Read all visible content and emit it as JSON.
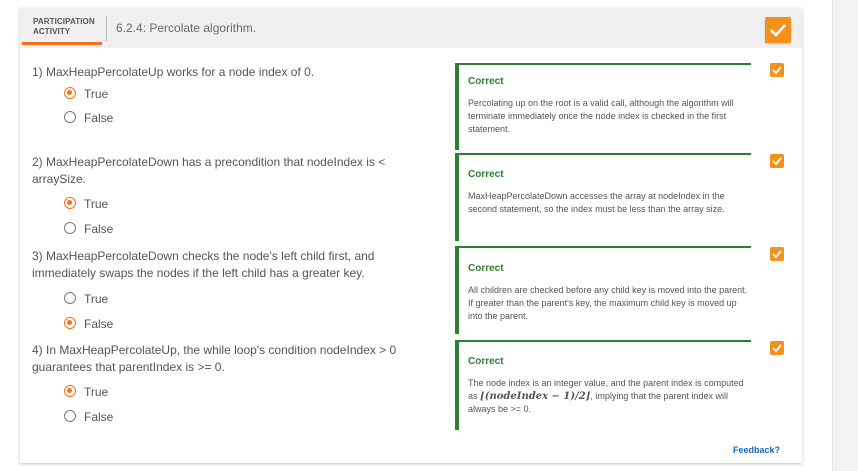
{
  "header": {
    "label_line1": "PARTICIPATION",
    "label_line2": "ACTIVITY",
    "title": "6.2.4: Percolate algorithm.",
    "completion_icon": "check-icon"
  },
  "questions": [
    {
      "text": "1) MaxHeapPercolateUp works for a node index of 0.",
      "options": [
        "True",
        "False"
      ],
      "selected": "True",
      "feedback_title": "Correct",
      "feedback_body": "Percolating up on the root is a valid call, although the algorithm will terminate immediately once the node index is checked in the first statement."
    },
    {
      "text": "2) MaxHeapPercolateDown has a precondition that nodeIndex is < arraySize.",
      "options": [
        "True",
        "False"
      ],
      "selected": "True",
      "feedback_title": "Correct",
      "feedback_body": "MaxHeapPercolateDown accesses the array at nodeIndex in the second statement, so the index must be less than the array size."
    },
    {
      "text": "3) MaxHeapPercolateDown checks the node's left child first, and immediately swaps the nodes if the left child has a greater key.",
      "options": [
        "True",
        "False"
      ],
      "selected": "False",
      "feedback_title": "Correct",
      "feedback_body": "All children are checked before any child key is moved into the parent. If greater than the parent's key, the maximum child key is moved up into the parent."
    },
    {
      "text": "4) In MaxHeapPercolateUp, the while loop's condition nodeIndex > 0 guarantees that parentIndex is >= 0.",
      "options": [
        "True",
        "False"
      ],
      "selected": "True",
      "feedback_title": "Correct",
      "feedback_body_pre": "The node index is an integer value, and the parent index is computed as ",
      "feedback_math": "⌊(nodeIndex − 1)/2⌋",
      "feedback_body_post": ", implying that the parent index will always be >= 0."
    }
  ],
  "feedback_link": "Feedback?",
  "colors": {
    "accent": "#f2711c",
    "correct": "#2e7d32",
    "link": "#1565c0",
    "check_bg": "#f2911c"
  }
}
